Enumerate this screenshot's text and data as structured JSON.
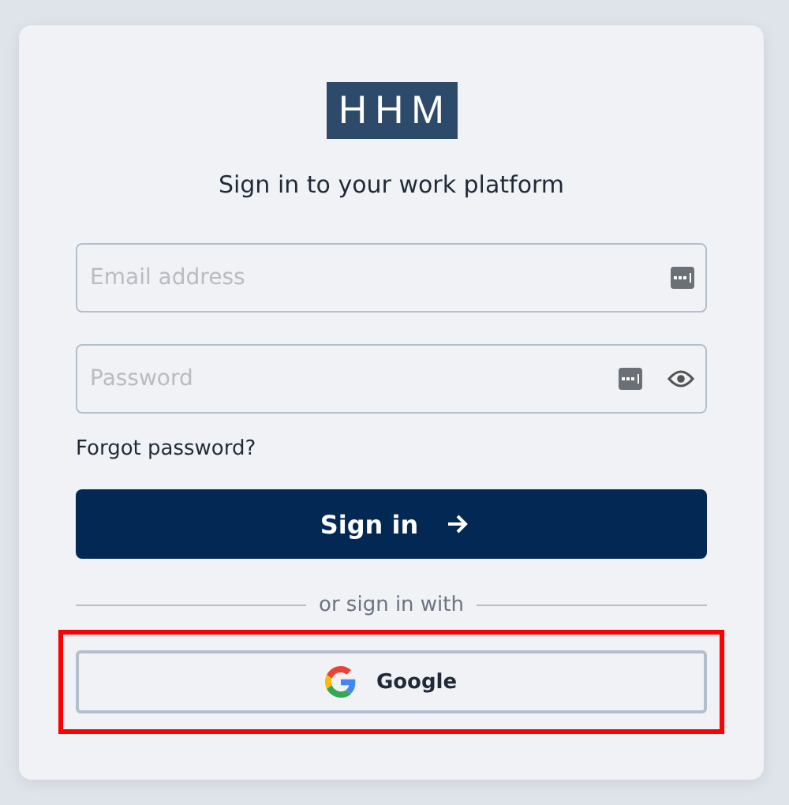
{
  "logo": {
    "text": "HHM"
  },
  "title": "Sign in to your work platform",
  "fields": [
    {
      "placeholder": "Email address",
      "show_toggle": false
    },
    {
      "placeholder": "Password",
      "show_toggle": true
    }
  ],
  "forgot_link": "Forgot password?",
  "submit_button": {
    "label": "Sign in"
  },
  "divider_text": "or sign in with",
  "providers": [
    {
      "label": "Google",
      "highlighted": true
    }
  ]
}
